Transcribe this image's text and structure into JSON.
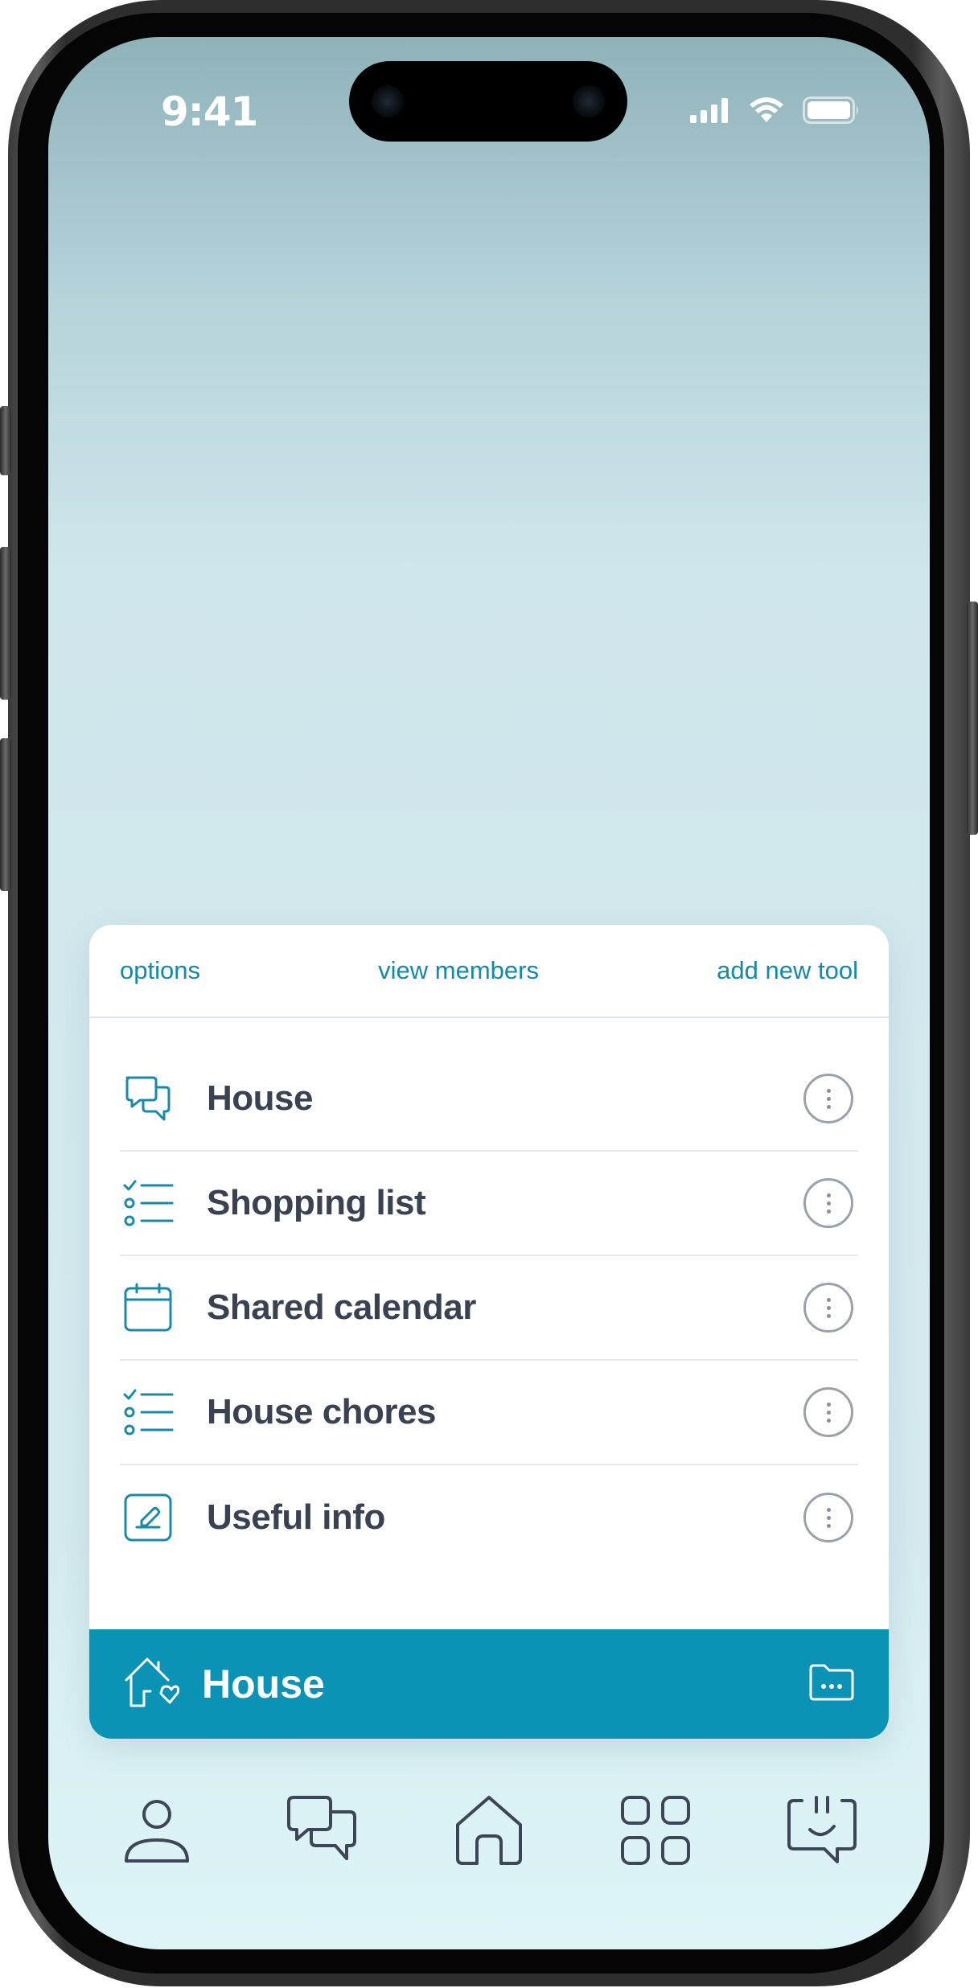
{
  "status_bar": {
    "time": "9:41"
  },
  "card": {
    "links": {
      "options": "options",
      "view_members": "view members",
      "add_new_tool": "add new tool"
    },
    "tools": [
      {
        "label": "House",
        "icon": "chat-bubbles-icon"
      },
      {
        "label": "Shopping list",
        "icon": "checklist-icon"
      },
      {
        "label": "Shared calendar",
        "icon": "calendar-icon"
      },
      {
        "label": "House chores",
        "icon": "checklist-icon"
      },
      {
        "label": "Useful info",
        "icon": "note-edit-icon"
      }
    ],
    "footer": {
      "title": "House",
      "icon": "house-heart-icon",
      "action_icon": "folder-more-icon"
    }
  },
  "tab_bar": {
    "items": [
      {
        "icon": "profile-icon"
      },
      {
        "icon": "chat-bubbles-icon"
      },
      {
        "icon": "home-icon"
      },
      {
        "icon": "grid-icon"
      },
      {
        "icon": "assistant-icon"
      }
    ]
  },
  "colors": {
    "accent": "#1689a6",
    "footer_bg": "#0a93b5",
    "text_primary": "#3a4150",
    "icon_gray": "#9aa1ab",
    "tab_icon": "#3c4656"
  }
}
